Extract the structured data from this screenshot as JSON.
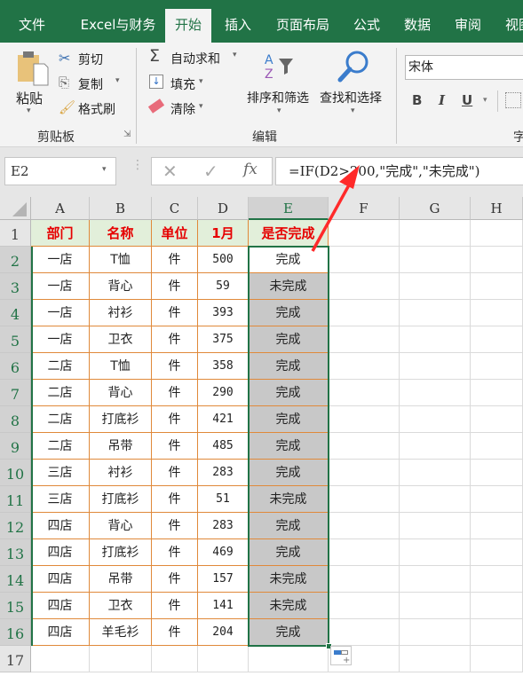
{
  "tabs": [
    "文件",
    "Excel与财务",
    "开始",
    "插入",
    "页面布局",
    "公式",
    "数据",
    "审阅",
    "视图"
  ],
  "ribbon": {
    "paste": "粘贴",
    "cut": "剪切",
    "copy": "复制",
    "format_painter": "格式刷",
    "clipboard_group": "剪贴板",
    "autosum": "自动求和",
    "fill": "填充",
    "clear": "清除",
    "sort_filter": "排序和筛选",
    "find_select": "查找和选择",
    "edit_group": "编辑",
    "font_name": "宋体",
    "bold": "B",
    "italic": "I",
    "underline": "U",
    "font_group": "字"
  },
  "formula_bar": {
    "name_box": "E2",
    "fx": "fx",
    "formula": "=IF(D2>200,\"完成\",\"未完成\")"
  },
  "columns": [
    "A",
    "B",
    "C",
    "D",
    "E",
    "F",
    "G",
    "H"
  ],
  "rows": [
    "1",
    "2",
    "3",
    "4",
    "5",
    "6",
    "7",
    "8",
    "9",
    "10",
    "11",
    "12",
    "13",
    "14",
    "15",
    "16",
    "17"
  ],
  "table": {
    "headers": [
      "部门",
      "名称",
      "单位",
      "1月",
      "是否完成"
    ],
    "data": [
      [
        "一店",
        "T恤",
        "件",
        "500",
        "完成"
      ],
      [
        "一店",
        "背心",
        "件",
        "59",
        "未完成"
      ],
      [
        "一店",
        "衬衫",
        "件",
        "393",
        "完成"
      ],
      [
        "一店",
        "卫衣",
        "件",
        "375",
        "完成"
      ],
      [
        "二店",
        "T恤",
        "件",
        "358",
        "完成"
      ],
      [
        "二店",
        "背心",
        "件",
        "290",
        "完成"
      ],
      [
        "二店",
        "打底衫",
        "件",
        "421",
        "完成"
      ],
      [
        "二店",
        "吊带",
        "件",
        "485",
        "完成"
      ],
      [
        "三店",
        "衬衫",
        "件",
        "283",
        "完成"
      ],
      [
        "三店",
        "打底衫",
        "件",
        "51",
        "未完成"
      ],
      [
        "四店",
        "背心",
        "件",
        "283",
        "完成"
      ],
      [
        "四店",
        "打底衫",
        "件",
        "469",
        "完成"
      ],
      [
        "四店",
        "吊带",
        "件",
        "157",
        "未完成"
      ],
      [
        "四店",
        "卫衣",
        "件",
        "141",
        "未完成"
      ],
      [
        "四店",
        "羊毛衫",
        "件",
        "204",
        "完成"
      ]
    ]
  },
  "colors": {
    "accent": "#217346",
    "header_text": "#e60000",
    "header_fill": "#e2efda",
    "border": "#e0893a",
    "selection_fill": "#c8c8c8",
    "arrow": "#ff2a2a"
  }
}
